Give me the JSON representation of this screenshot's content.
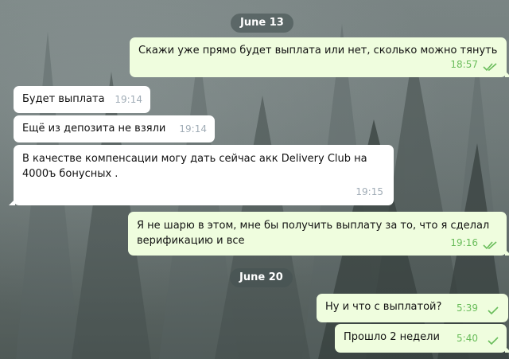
{
  "conversation": {
    "days": [
      {
        "date_label": "June 13",
        "messages": [
          {
            "direction": "outgoing",
            "text": "Скажи уже прямо будет выплата или нет, сколько можно тянуть",
            "time": "18:57",
            "status": "read"
          },
          {
            "direction": "incoming",
            "text": "Будет выплата",
            "time": "19:14"
          },
          {
            "direction": "incoming",
            "text": "Ещё из депозита не взяли",
            "time": "19:14"
          },
          {
            "direction": "incoming",
            "text_line1": "В качестве компенсации могу дать сейчас акк Delivery Club на",
            "text_line2": "4000ъ бонусных .",
            "time": "19:15"
          },
          {
            "direction": "outgoing",
            "text_line1": "Я не шарю в этом, мне бы получить выплату за то, что я сделал",
            "text_line2": "верификацию и все",
            "time": "19:16",
            "status": "read"
          }
        ]
      },
      {
        "date_label": "June 20",
        "messages": [
          {
            "direction": "outgoing",
            "text": "Ну и что с выплатой?",
            "time": "5:39",
            "status": "sent"
          },
          {
            "direction": "outgoing",
            "text": "Прошло 2 недели",
            "time": "5:40",
            "status": "sent"
          }
        ]
      }
    ]
  },
  "colors": {
    "outgoing_bubble": "#effdde",
    "incoming_bubble": "#ffffff",
    "outgoing_time": "#6abd5b",
    "incoming_time": "#a0acb6",
    "date_pill": "#465252"
  },
  "icons": {
    "read_status": "double-check-icon",
    "sent_status": "single-check-icon"
  }
}
